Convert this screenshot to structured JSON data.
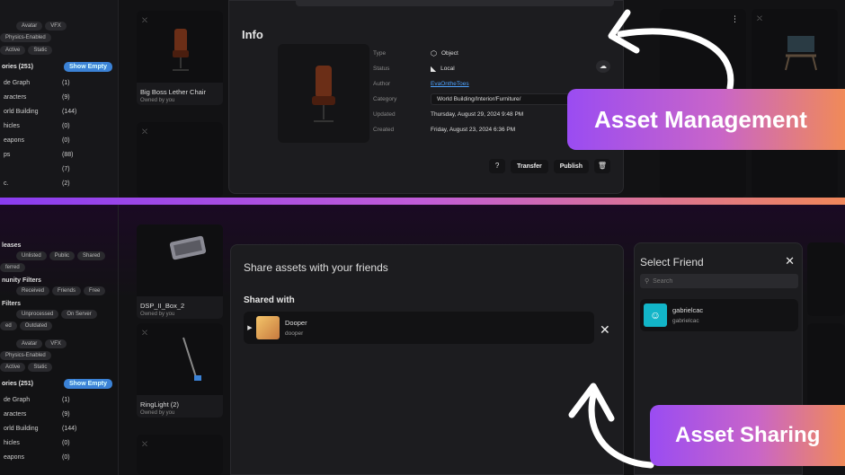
{
  "top_sidebar": {
    "chips_row1": [
      "Avatar",
      "VFX",
      "Physics-Enabled"
    ],
    "chips_row2": [
      "Active",
      "Static"
    ],
    "categories_label": "ories (251)",
    "show_empty": "Show Empty",
    "categories": [
      {
        "label": "de Graph",
        "count": "(1)"
      },
      {
        "label": "aracters",
        "count": "(9)"
      },
      {
        "label": "orld Building",
        "count": "(144)"
      },
      {
        "label": "hicles",
        "count": "(0)"
      },
      {
        "label": "eapons",
        "count": "(0)"
      },
      {
        "label": "ps",
        "count": "(88)"
      },
      {
        "label": "",
        "count": "(7)"
      },
      {
        "label": "c.",
        "count": "(2)"
      }
    ]
  },
  "top_cards": [
    {
      "name": "Big Boss Lether Chair",
      "owner": "Owned by you"
    }
  ],
  "info": {
    "title": "Info",
    "rows": [
      {
        "k": "Type",
        "v": "Object"
      },
      {
        "k": "Status",
        "v": "Local"
      },
      {
        "k": "Author",
        "v": "EvaOntheToes"
      },
      {
        "k": "Category",
        "v": "World Building/Interior/Furniture/"
      },
      {
        "k": "Updated",
        "v": "Thursday, August 29, 2024 9:48 PM"
      },
      {
        "k": "Created",
        "v": "Friday, August 23, 2024 6:36 PM"
      }
    ],
    "help": "?",
    "transfer": "Transfer",
    "publish": "Publish"
  },
  "bottom_sidebar": {
    "releases_label": "leases",
    "chips_releases": [
      "Unlisted",
      "Public",
      "Shared"
    ],
    "chip_ferred": "ferred",
    "community_label": "nunity Filters",
    "chips_community": [
      "Received",
      "Friends",
      "Free"
    ],
    "filters_label": "Filters",
    "chips_filters": [
      "Unprocessed",
      "On Server"
    ],
    "chips_filters2": [
      "ed",
      "Outdated"
    ],
    "chips_type": [
      "Avatar",
      "VFX",
      "Physics-Enabled"
    ],
    "chips_state": [
      "Active",
      "Static"
    ],
    "categories_label": "ories (251)",
    "show_empty": "Show Empty",
    "categories": [
      {
        "label": "de Graph",
        "count": "(1)"
      },
      {
        "label": "aracters",
        "count": "(9)"
      },
      {
        "label": "orld Building",
        "count": "(144)"
      },
      {
        "label": "hicles",
        "count": "(0)"
      },
      {
        "label": "eapons",
        "count": "(0)"
      }
    ]
  },
  "bottom_cards": [
    {
      "name": "DSP_II_Box_2",
      "owner": "Owned by you"
    },
    {
      "name": "RingLight (2)",
      "owner": "Owned by you"
    }
  ],
  "share": {
    "title": "Share assets with your friends",
    "shared_with": "Shared with",
    "user": {
      "name": "Dooper",
      "handle": "dooper"
    }
  },
  "friend": {
    "title": "Select Friend",
    "search_placeholder": "Search",
    "user": {
      "name": "gabrielcac",
      "handle": "gabrielcac"
    }
  },
  "callouts": {
    "management": "Asset Management",
    "sharing": "Asset Sharing"
  },
  "colors": {
    "accent_start": "#9a4cf2",
    "accent_end": "#f08a58",
    "link": "#4da3ff",
    "show_empty": "#3b82d6",
    "friend_avatar": "#12b5c8"
  }
}
